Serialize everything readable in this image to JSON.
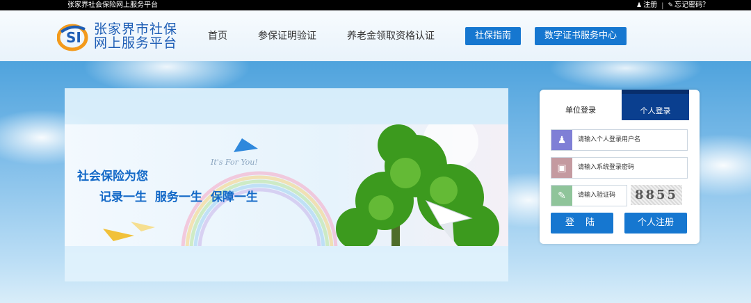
{
  "topbar": {
    "site_name": "张家界社会保险网上服务平台",
    "register": "注册",
    "separator": "|",
    "forgot_password": "忘记密码？"
  },
  "header": {
    "logo_line1": "张家界市社保",
    "logo_line2": "网上服务平台",
    "nav": {
      "home": "首页",
      "insurance_verify": "参保证明验证",
      "pension_certify": "养老金领取资格认证",
      "guide": "社保指南",
      "digital_cert": "数字证书服务中心"
    }
  },
  "banner": {
    "slogan1": "社会保险为您",
    "slogan2": "记录一生 服务一生 保障一生",
    "script": "It's For You!"
  },
  "login": {
    "tab_unit": "单位登录",
    "tab_personal": "个人登录",
    "username_placeholder": "请输入个人登录用户名",
    "password_placeholder": "请输入系统登录密码",
    "captcha_placeholder": "请输入验证码",
    "captcha_value": "8855",
    "login_button": "登 陆",
    "register_button": "个人注册"
  },
  "colors": {
    "primary_blue": "#1677d0",
    "active_tab": "#0a3f8f"
  }
}
